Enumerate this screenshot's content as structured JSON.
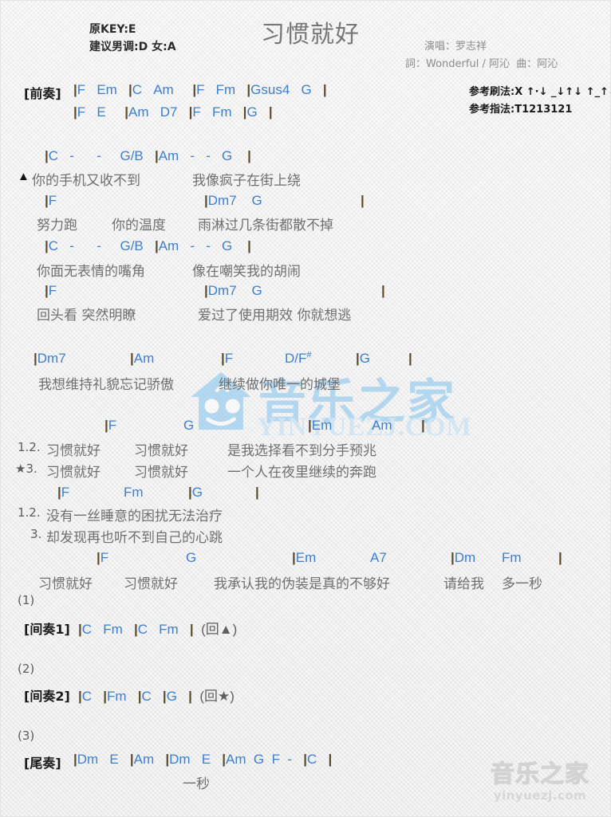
{
  "page": {
    "background": "#f1f1f1",
    "chord_color": "#3c7fd0",
    "lyric_color": "#6f6f6f",
    "bar_color": "#5a4a2a"
  },
  "header": {
    "title": "习惯就好",
    "orig_key": "原KEY:E",
    "suggest_key": "建议男调:D 女:A",
    "singer": "演唱：罗志祥",
    "writers": "詞：Wonderful / 阿沁  曲：阿沁",
    "strum_label": "参考刷法:X ↑·↓ _↓↑↓ ↑_↑↓",
    "fingering_label": "参考指法:T1213121"
  },
  "sections": {
    "intro_label": "[前奏]",
    "intro_line1": "|F   Em   |C   Am    |F   Fm   |Gsus4   G   |",
    "intro_line2": "|F   E    |Am   D7   |F   Fm   |G   |",
    "interlude1_label": "[间奏1]",
    "interlude1_line": "|C   Fm   |C   Fm   |  (回▲)",
    "interlude2_label": "[间奏2]",
    "interlude2_line": "|C   |Fm   |C   |G   |  (回★)",
    "outro_label": "[尾奏]",
    "outro_line": "|Dm   E   |Am   |Dm   E   |Am  G  F  -   |C   |",
    "outro_lyric": "一秒",
    "ending1": "(1)",
    "ending2": "(2)",
    "ending3": "(3)"
  },
  "verse1": {
    "chords_a": [
      "|C",
      "-",
      "-",
      "G/B",
      "|Am",
      "-",
      "-",
      "G",
      "|"
    ],
    "marker": "▲",
    "lyric_a1": "你的手机又收不到",
    "lyric_a2": "我像疯子在街上绕",
    "chords_b": [
      "|F",
      "|Dm7",
      "G",
      "|"
    ],
    "lyric_b1": "努力跑",
    "lyric_b2": "你的温度",
    "lyric_b3": "雨淋过几条街都散不掉"
  },
  "verse2": {
    "chords_a": [
      "|C",
      "-",
      "-",
      "G/B",
      "|Am",
      "-",
      "-",
      "G",
      "|"
    ],
    "lyric_a1": "你面无表情的嘴角",
    "lyric_a2": "像在嘲笑我的胡闹",
    "chords_b": [
      "|F",
      "|Dm7",
      "G",
      "|"
    ],
    "lyric_b1": "回头看 突然明瞭",
    "lyric_b2": "爱过了使用期效 你就想逃"
  },
  "prechorus": {
    "chords": [
      "|Dm7",
      "|Am",
      "|F",
      "D/F#",
      "|G",
      "|"
    ],
    "lyric1": "我想维持礼貌忘记骄傲",
    "lyric2": "继续做你唯一的城堡"
  },
  "chorus": {
    "chords_1": [
      "|F",
      "G",
      "|Em",
      "Am",
      "|"
    ],
    "num_12": "1.2.",
    "marker_3": "★3.",
    "line12_a": "习惯就好",
    "line12_b": "习惯就好",
    "line12_c": "是我选择看不到分手预兆",
    "line3_a": "习惯就好",
    "line3_b": "习惯就好",
    "line3_c": "一个人在夜里继续的奔跑",
    "chords_2": [
      "|F",
      "Fm",
      "|G",
      "|"
    ],
    "num_12b": "1.2.",
    "num_3b": "3.",
    "line12_d": "没有一丝睡意的困扰无法治疗",
    "line3_d": "却发现再也听不到自己的心跳",
    "chords_3": [
      "|F",
      "G",
      "|Em",
      "A7",
      "|Dm",
      "Fm",
      "|"
    ],
    "line_final_a": "习惯就好",
    "line_final_b": "习惯就好",
    "line_final_c": "我承认我的伪装是真的不够好",
    "line_final_d": "请给我",
    "line_final_e": "多一秒"
  },
  "watermarks": {
    "center_cn": "音乐之家",
    "center_en": "YINYUEZJ.COM",
    "bottom_cn": "音乐之家",
    "bottom_en": "yinyuezj.com"
  }
}
